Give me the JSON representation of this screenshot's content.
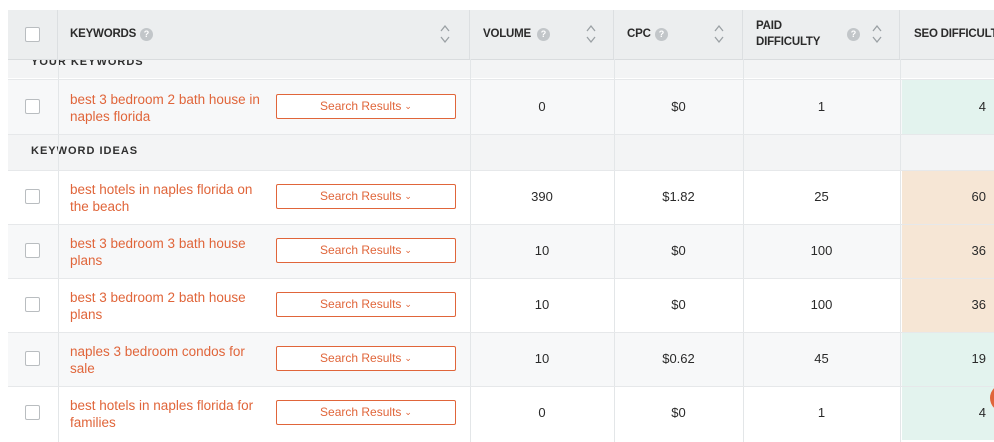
{
  "header": {
    "columns": [
      {
        "label": "KEYWORDS"
      },
      {
        "label": "VOLUME"
      },
      {
        "label": "CPC"
      },
      {
        "label": "PAID",
        "label2": "DIFFICULTY"
      },
      {
        "label": "SEO DIFFICULTY"
      }
    ]
  },
  "sections": {
    "your_keywords": "YOUR KEYWORDS",
    "keyword_ideas": "KEYWORD IDEAS"
  },
  "search_results_label": "Search Results",
  "your_keywords": [
    {
      "kw1": "best 3 bedroom 2 bath house in",
      "kw2": "naples florida",
      "volume": "0",
      "cpc": "$0",
      "paid": "1",
      "seo": "4",
      "seo_color": "#e3f3ee"
    }
  ],
  "keyword_ideas": [
    {
      "kw1": "best hotels in naples florida on",
      "kw2": "the beach",
      "volume": "390",
      "cpc": "$1.82",
      "paid": "25",
      "seo": "60",
      "seo_color": "#f6e6d5"
    },
    {
      "kw1": "best 3 bedroom 3 bath house",
      "kw2": "plans",
      "volume": "10",
      "cpc": "$0",
      "paid": "100",
      "seo": "36",
      "seo_color": "#f6e6d5"
    },
    {
      "kw1": "best 3 bedroom 2 bath house",
      "kw2": "plans",
      "volume": "10",
      "cpc": "$0",
      "paid": "100",
      "seo": "36",
      "seo_color": "#f6e6d5"
    },
    {
      "kw1": "naples 3 bedroom condos for",
      "kw2": "sale",
      "volume": "10",
      "cpc": "$0.62",
      "paid": "45",
      "seo": "19",
      "seo_color": "#e3f3ee"
    },
    {
      "kw1": "best hotels in naples florida for",
      "kw2": "families",
      "volume": "0",
      "cpc": "$0",
      "paid": "1",
      "seo": "4",
      "seo_color": "#e3f3ee"
    }
  ],
  "colors": {
    "accent": "#e0653a",
    "header_bg": "#eceeef",
    "seo_easy": "#e3f3ee",
    "seo_medium": "#f6e6d5"
  },
  "icons": [
    "help-icon",
    "sort-icon",
    "chevron-down-icon",
    "checkbox"
  ]
}
